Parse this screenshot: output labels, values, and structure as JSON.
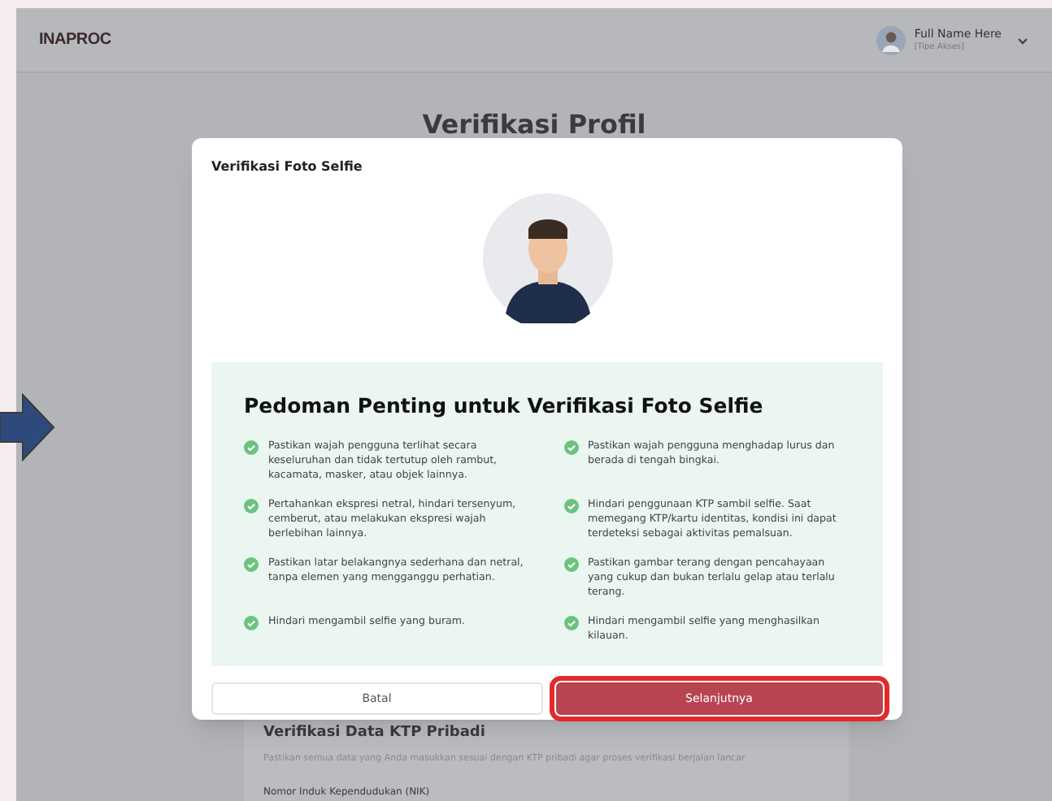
{
  "header": {
    "logo": "INAPROC",
    "user": {
      "name": "Full Name Here",
      "role": "[Tipe Akses]"
    }
  },
  "page": {
    "title": "Verifikasi Profil",
    "section_title": "Verifikasi Data KTP Pribadi",
    "section_description": "Pastikan semua data yang Anda masukkan sesuai dengan KTP pribadi agar proses verifikasi berjalan lancar",
    "field_label": "Nomor Induk Kependudukan (NIK)"
  },
  "modal": {
    "title": "Verifikasi Foto Selfie",
    "guide_title": "Pedoman Penting untuk Verifikasi Foto Selfie",
    "guidelines": [
      {
        "text": "Pastikan wajah pengguna terlihat secara keseluruhan dan tidak tertutup oleh rambut, kacamata, masker, atau objek lainnya."
      },
      {
        "text": "Pastikan wajah pengguna menghadap lurus dan berada di tengah bingkai."
      },
      {
        "text": "Pertahankan ekspresi netral, hindari tersenyum, cemberut, atau melakukan ekspresi wajah berlebihan lainnya."
      },
      {
        "text": "Hindari penggunaan KTP sambil selfie. Saat memegang KTP/kartu identitas, kondisi ini dapat terdeteksi sebagai aktivitas pemalsuan."
      },
      {
        "text": "Pastikan latar belakangnya sederhana dan netral, tanpa elemen yang mengganggu perhatian."
      },
      {
        "text": "Pastikan gambar terang dengan pencahayaan yang cukup dan bukan terlalu gelap atau terlalu terang."
      },
      {
        "text": "Hindari mengambil selfie yang buram."
      },
      {
        "text": "Hindari mengambil selfie yang menghasilkan kilauan."
      }
    ],
    "buttons": [
      {
        "label": "Batal",
        "kind": "secondary",
        "highlighted": false
      },
      {
        "label": "Selanjutnya",
        "kind": "primary",
        "highlighted": true
      }
    ]
  }
}
